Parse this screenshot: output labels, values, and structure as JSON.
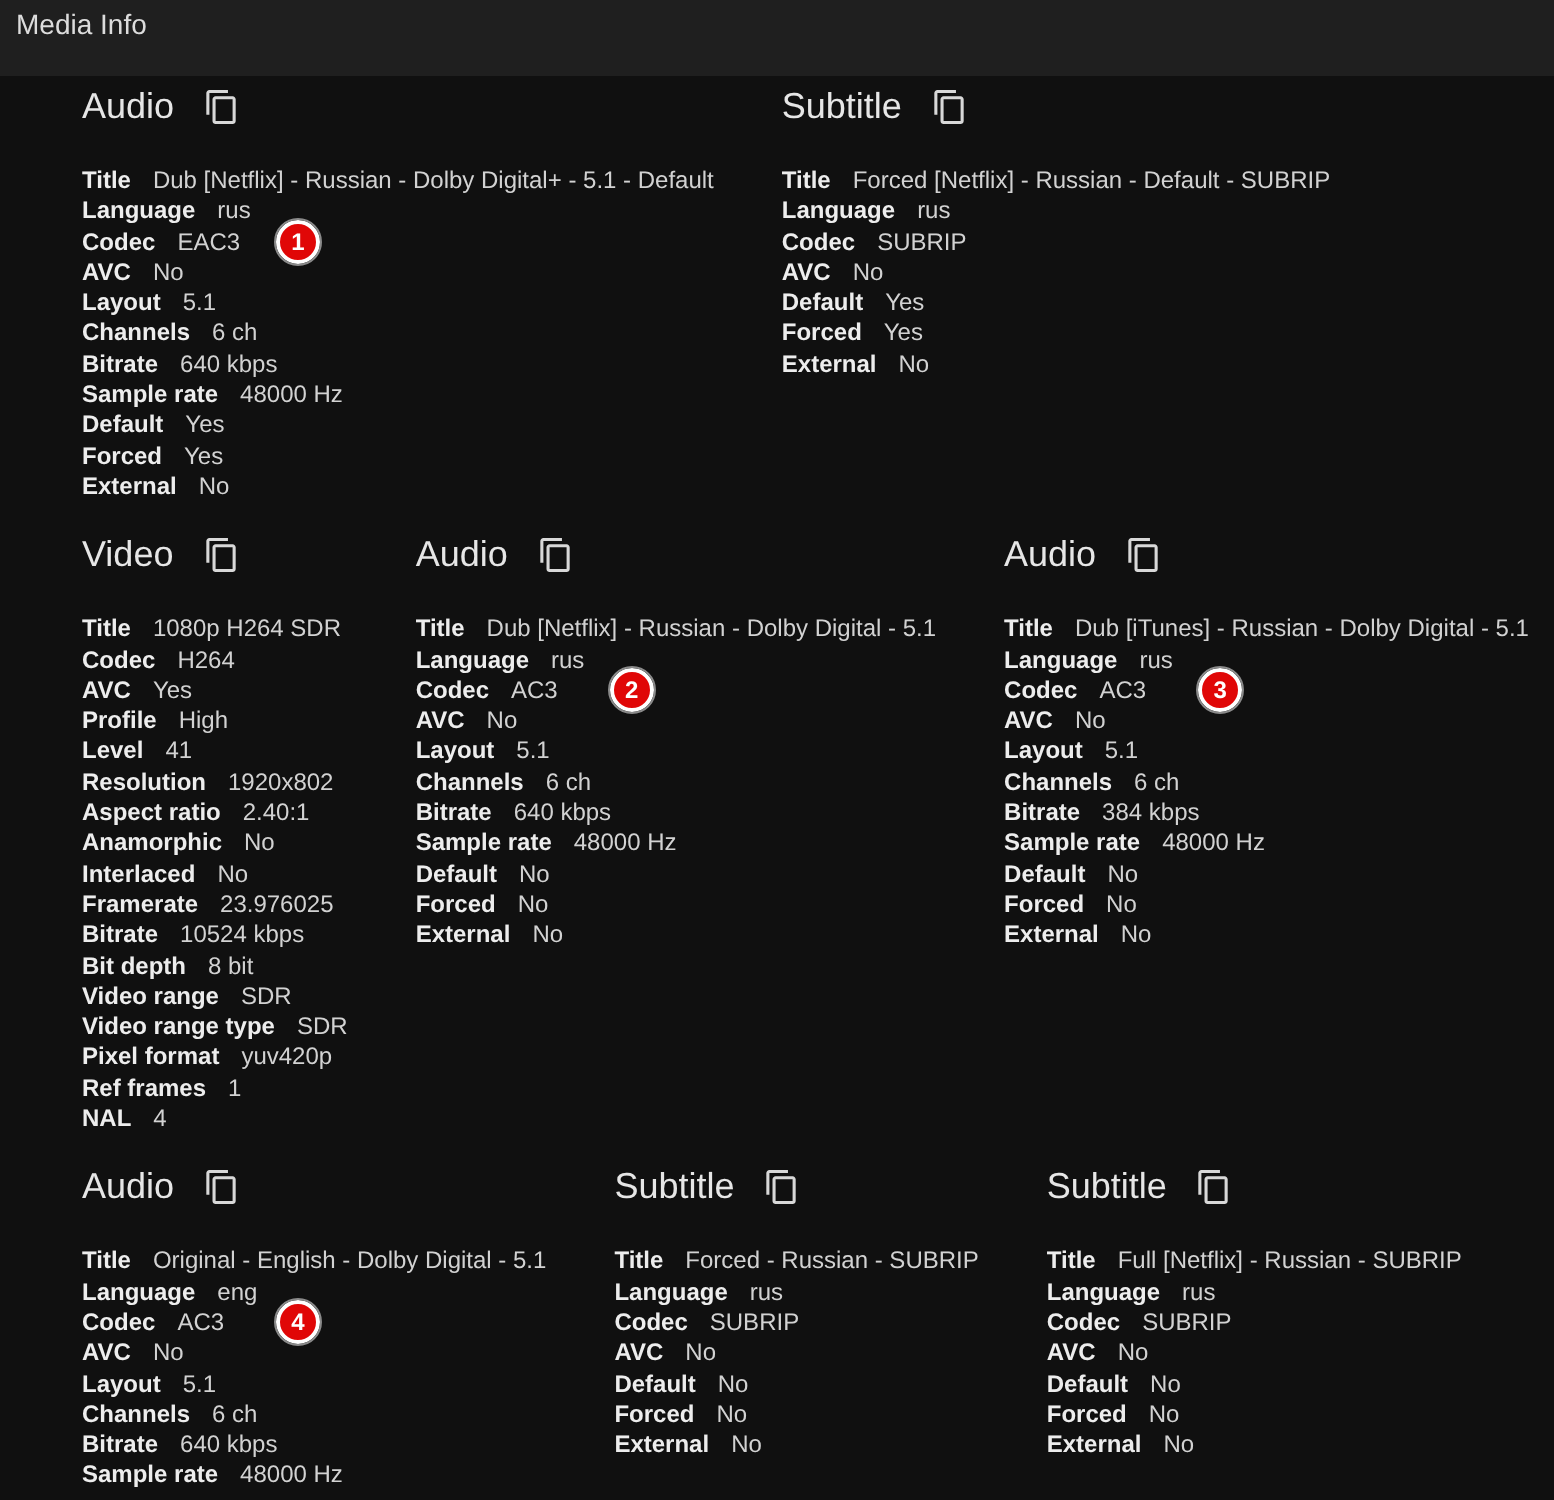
{
  "window": {
    "title": "Media Info"
  },
  "streams": [
    {
      "heading": "Audio",
      "marker": "1",
      "fields": [
        {
          "label": "Title",
          "value": "Dub [Netflix] - Russian - Dolby Digital+ - 5.1 - Default"
        },
        {
          "label": "Language",
          "value": "rus"
        },
        {
          "label": "Codec",
          "value": "EAC3"
        },
        {
          "label": "AVC",
          "value": "No"
        },
        {
          "label": "Layout",
          "value": "5.1"
        },
        {
          "label": "Channels",
          "value": "6 ch"
        },
        {
          "label": "Bitrate",
          "value": "640 kbps"
        },
        {
          "label": "Sample rate",
          "value": "48000 Hz"
        },
        {
          "label": "Default",
          "value": "Yes"
        },
        {
          "label": "Forced",
          "value": "Yes"
        },
        {
          "label": "External",
          "value": "No"
        }
      ]
    },
    {
      "heading": "Subtitle",
      "fields": [
        {
          "label": "Title",
          "value": "Forced [Netflix] - Russian - Default - SUBRIP"
        },
        {
          "label": "Language",
          "value": "rus"
        },
        {
          "label": "Codec",
          "value": "SUBRIP"
        },
        {
          "label": "AVC",
          "value": "No"
        },
        {
          "label": "Default",
          "value": "Yes"
        },
        {
          "label": "Forced",
          "value": "Yes"
        },
        {
          "label": "External",
          "value": "No"
        }
      ]
    },
    {
      "heading": "Video",
      "fields": [
        {
          "label": "Title",
          "value": "1080p H264 SDR"
        },
        {
          "label": "Codec",
          "value": "H264"
        },
        {
          "label": "AVC",
          "value": "Yes"
        },
        {
          "label": "Profile",
          "value": "High"
        },
        {
          "label": "Level",
          "value": "41"
        },
        {
          "label": "Resolution",
          "value": "1920x802"
        },
        {
          "label": "Aspect ratio",
          "value": "2.40:1"
        },
        {
          "label": "Anamorphic",
          "value": "No"
        },
        {
          "label": "Interlaced",
          "value": "No"
        },
        {
          "label": "Framerate",
          "value": "23.976025"
        },
        {
          "label": "Bitrate",
          "value": "10524 kbps"
        },
        {
          "label": "Bit depth",
          "value": "8 bit"
        },
        {
          "label": "Video range",
          "value": "SDR"
        },
        {
          "label": "Video range type",
          "value": "SDR"
        },
        {
          "label": "Pixel format",
          "value": "yuv420p"
        },
        {
          "label": "Ref frames",
          "value": "1"
        },
        {
          "label": "NAL",
          "value": "4"
        }
      ]
    },
    {
      "heading": "Audio",
      "marker": "2",
      "fields": [
        {
          "label": "Title",
          "value": "Dub [Netflix] - Russian - Dolby Digital - 5.1"
        },
        {
          "label": "Language",
          "value": "rus"
        },
        {
          "label": "Codec",
          "value": "AC3"
        },
        {
          "label": "AVC",
          "value": "No"
        },
        {
          "label": "Layout",
          "value": "5.1"
        },
        {
          "label": "Channels",
          "value": "6 ch"
        },
        {
          "label": "Bitrate",
          "value": "640 kbps"
        },
        {
          "label": "Sample rate",
          "value": "48000 Hz"
        },
        {
          "label": "Default",
          "value": "No"
        },
        {
          "label": "Forced",
          "value": "No"
        },
        {
          "label": "External",
          "value": "No"
        }
      ]
    },
    {
      "heading": "Audio",
      "marker": "3",
      "fields": [
        {
          "label": "Title",
          "value": "Dub [iTunes] - Russian - Dolby Digital - 5.1"
        },
        {
          "label": "Language",
          "value": "rus"
        },
        {
          "label": "Codec",
          "value": "AC3"
        },
        {
          "label": "AVC",
          "value": "No"
        },
        {
          "label": "Layout",
          "value": "5.1"
        },
        {
          "label": "Channels",
          "value": "6 ch"
        },
        {
          "label": "Bitrate",
          "value": "384 kbps"
        },
        {
          "label": "Sample rate",
          "value": "48000 Hz"
        },
        {
          "label": "Default",
          "value": "No"
        },
        {
          "label": "Forced",
          "value": "No"
        },
        {
          "label": "External",
          "value": "No"
        }
      ]
    },
    {
      "heading": "Audio",
      "marker": "4",
      "fields": [
        {
          "label": "Title",
          "value": "Original - English - Dolby Digital - 5.1"
        },
        {
          "label": "Language",
          "value": "eng"
        },
        {
          "label": "Codec",
          "value": "AC3"
        },
        {
          "label": "AVC",
          "value": "No"
        },
        {
          "label": "Layout",
          "value": "5.1"
        },
        {
          "label": "Channels",
          "value": "6 ch"
        },
        {
          "label": "Bitrate",
          "value": "640 kbps"
        },
        {
          "label": "Sample rate",
          "value": "48000 Hz"
        }
      ]
    },
    {
      "heading": "Subtitle",
      "fields": [
        {
          "label": "Title",
          "value": "Forced - Russian - SUBRIP"
        },
        {
          "label": "Language",
          "value": "rus"
        },
        {
          "label": "Codec",
          "value": "SUBRIP"
        },
        {
          "label": "AVC",
          "value": "No"
        },
        {
          "label": "Default",
          "value": "No"
        },
        {
          "label": "Forced",
          "value": "No"
        },
        {
          "label": "External",
          "value": "No"
        }
      ]
    },
    {
      "heading": "Subtitle",
      "fields": [
        {
          "label": "Title",
          "value": "Full [Netflix] - Russian - SUBRIP"
        },
        {
          "label": "Language",
          "value": "rus"
        },
        {
          "label": "Codec",
          "value": "SUBRIP"
        },
        {
          "label": "AVC",
          "value": "No"
        },
        {
          "label": "Default",
          "value": "No"
        },
        {
          "label": "Forced",
          "value": "No"
        },
        {
          "label": "External",
          "value": "No"
        }
      ]
    }
  ]
}
